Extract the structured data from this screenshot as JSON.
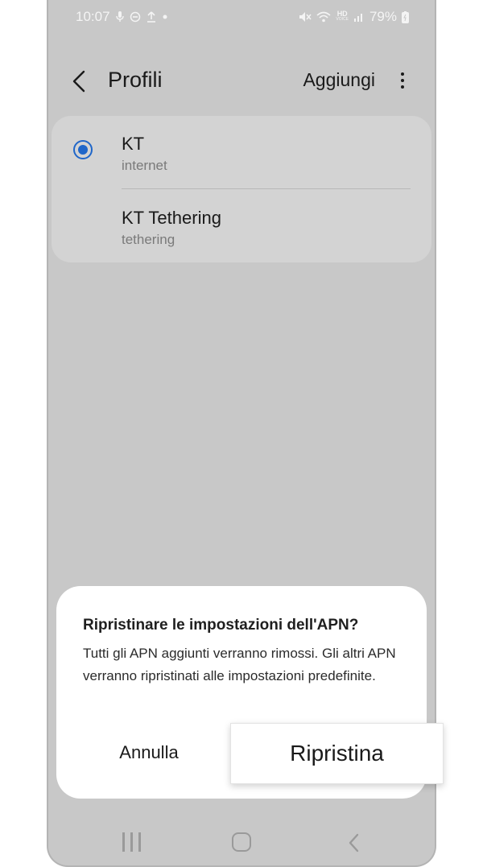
{
  "status_bar": {
    "time": "10:07",
    "battery": "79%",
    "icons_left": [
      "mic-icon",
      "dnd-icon",
      "upload-icon",
      "dot-icon"
    ],
    "icons_right": [
      "mute-icon",
      "wifi-icon",
      "hd-voice-icon",
      "signal-icon",
      "battery-icon"
    ],
    "hd_label": "HD",
    "voice_label": "VOICE"
  },
  "header": {
    "title": "Profili",
    "add_label": "Aggiungi"
  },
  "profiles": [
    {
      "name": "KT",
      "subtitle": "internet",
      "selected": true
    },
    {
      "name": "KT Tethering",
      "subtitle": "tethering",
      "selected": false
    }
  ],
  "dialog": {
    "title": "Ripristinare le impostazioni dell'APN?",
    "body": "Tutti gli APN aggiunti verranno rimossi. Gli altri APN verranno ripristinati alle impostazioni predefinite.",
    "cancel_label": "Annulla",
    "reset_label": "Ripristina"
  },
  "colors": {
    "accent": "#1f66c9",
    "screen_dimmed": "#c8c8c8"
  }
}
